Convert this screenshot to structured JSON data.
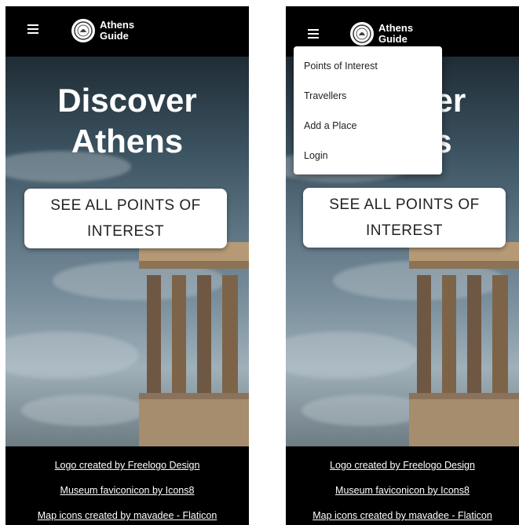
{
  "brand": {
    "line1": "Athens",
    "line2": "Guide"
  },
  "hero": {
    "title_line1": "Discover",
    "title_line2": "Athens",
    "cta_label": "SEE ALL POINTS OF INTEREST"
  },
  "menu": {
    "items": [
      {
        "label": "Points of Interest"
      },
      {
        "label": "Travellers"
      },
      {
        "label": "Add a Place"
      },
      {
        "label": "Login"
      }
    ]
  },
  "footer": {
    "links": [
      {
        "label": "Logo created by Freelogo Design"
      },
      {
        "label": "Museum faviconicon by Icons8"
      },
      {
        "label": "Map icons created by mavadee - Flaticon"
      }
    ]
  },
  "colors": {
    "header_bg": "#000000",
    "cta_bg": "#ffffff",
    "text_on_dark": "#ffffff"
  },
  "icons": [
    "hamburger-menu-icon",
    "athens-guide-logo-icon"
  ]
}
